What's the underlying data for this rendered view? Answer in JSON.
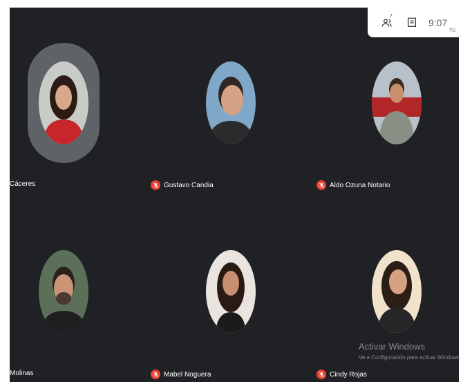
{
  "topbar": {
    "people_count": "7",
    "time": "9:07",
    "time_sub": "TÚ"
  },
  "participants": [
    {
      "name": "Cáceres",
      "muted": false,
      "active_speaker": true
    },
    {
      "name": "Gustavo Candia",
      "muted": true
    },
    {
      "name": "Aldo Ozuna Notario",
      "muted": true
    },
    {
      "name": "Molinas",
      "muted": false
    },
    {
      "name": "Mabel Noguera",
      "muted": true
    },
    {
      "name": "Cindy Rojas",
      "muted": true
    }
  ],
  "watermark": {
    "title": "Activar Windows",
    "subtitle": "Ve a Configuración para activar Windows."
  },
  "colors": {
    "background": "#202124",
    "mic_muted": "#ea4335",
    "speaker_ring": "#5f6368"
  }
}
